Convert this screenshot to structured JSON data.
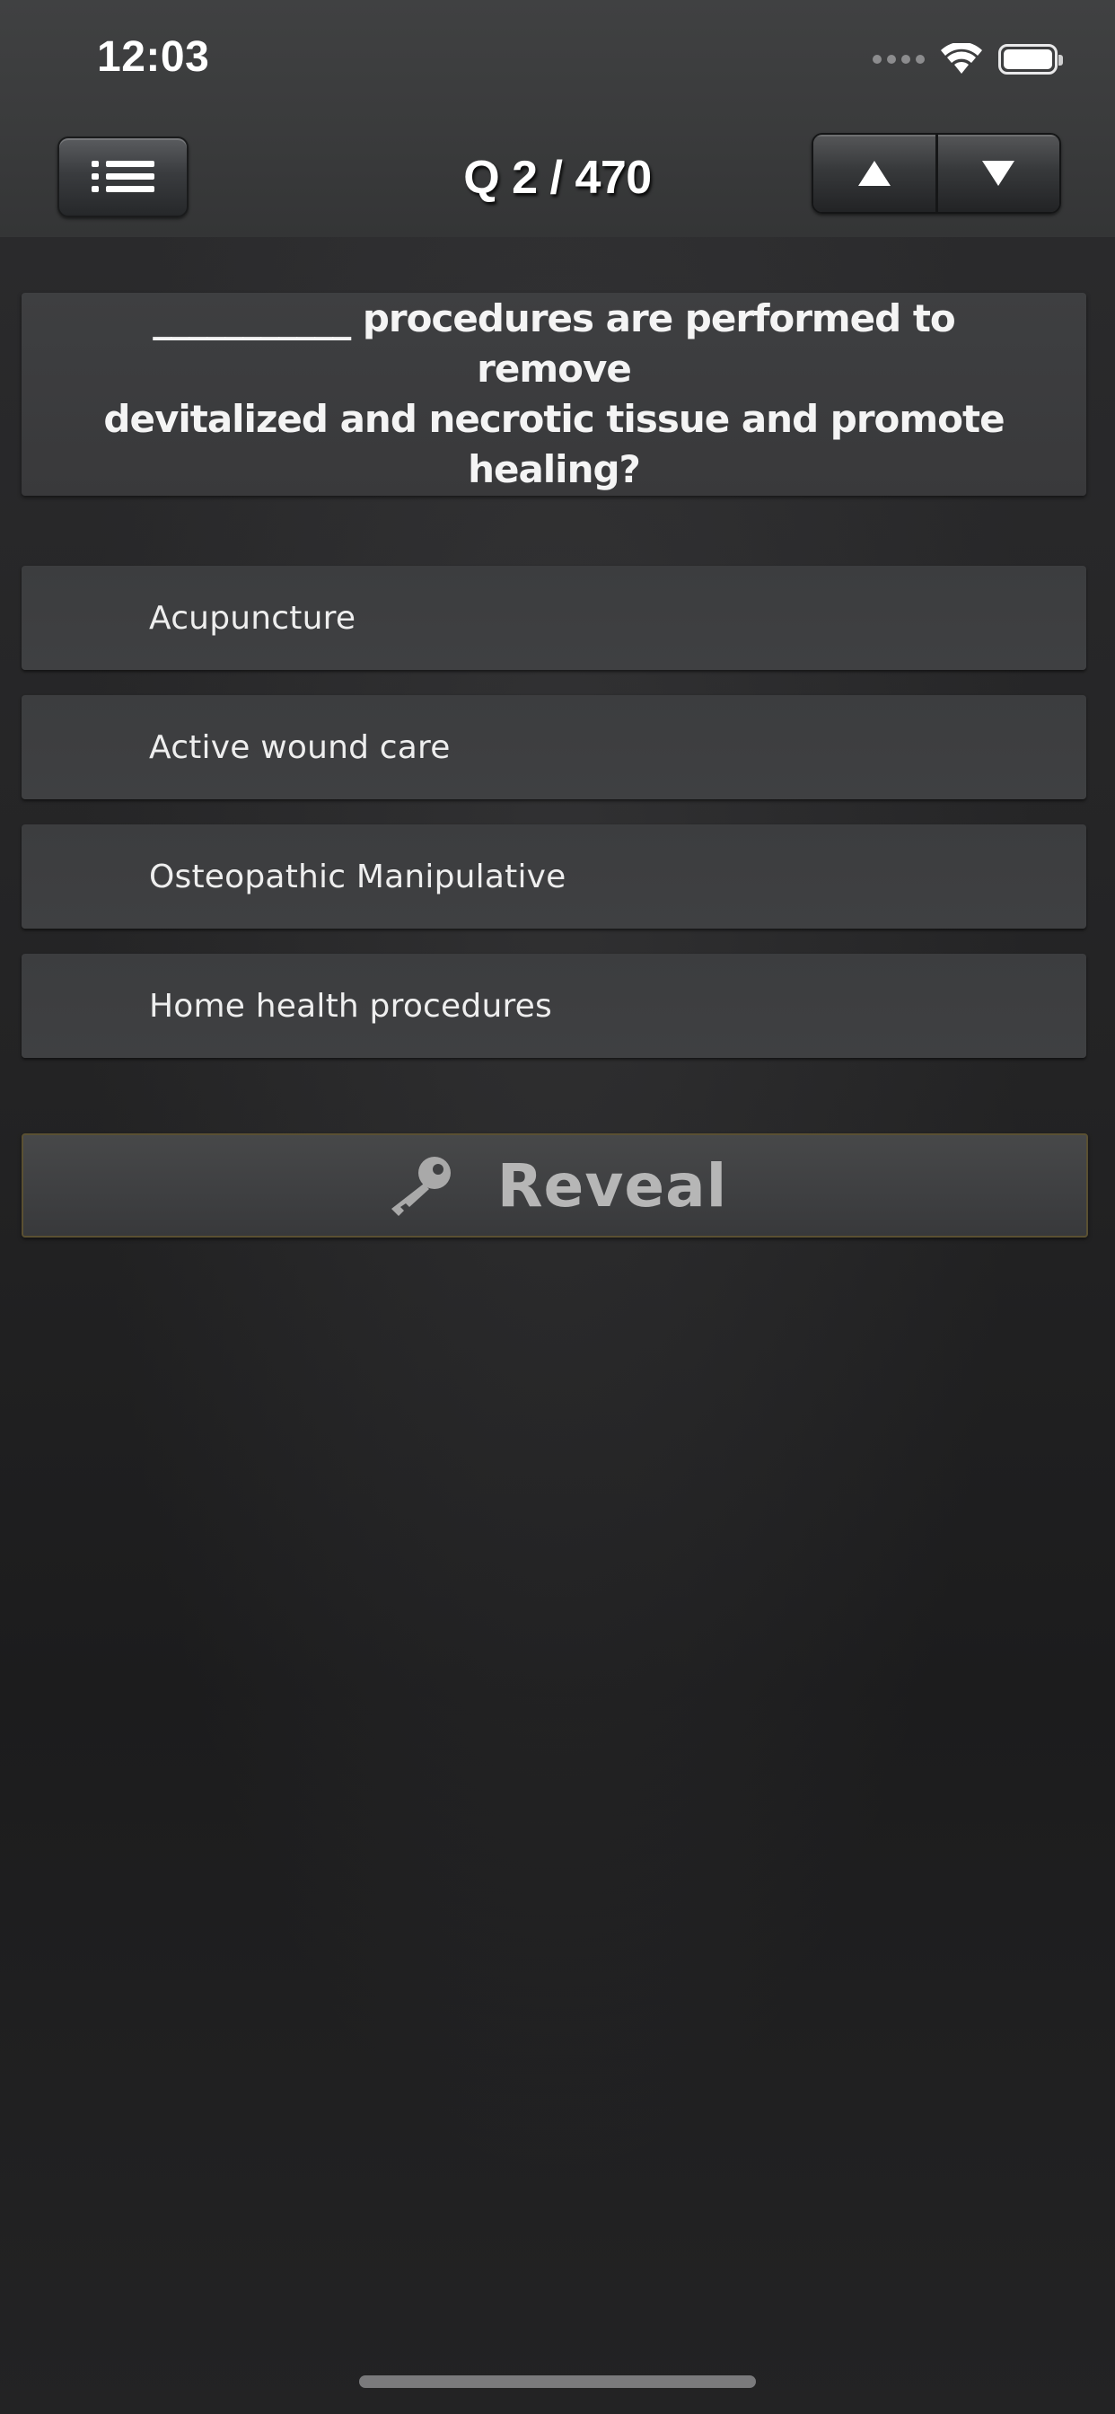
{
  "status_bar": {
    "time": "12:03"
  },
  "nav": {
    "title": "Q 2 / 470",
    "menu_icon": "list-icon",
    "up_icon": "triangle-up-icon",
    "down_icon": "triangle-down-icon"
  },
  "question": {
    "line1": "___________ procedures are performed to remove",
    "line2": "devitalized and necrotic tissue and promote healing?"
  },
  "answers": [
    {
      "label": "Acupuncture"
    },
    {
      "label": "Active wound care"
    },
    {
      "label": "Osteopathic Manipulative"
    },
    {
      "label": "Home health procedures"
    }
  ],
  "reveal": {
    "label": "Reveal",
    "icon": "key-icon"
  },
  "colors": {
    "text": "#ffffff",
    "reveal_text": "#b6b6b6",
    "reveal_border": "#5a5032"
  }
}
